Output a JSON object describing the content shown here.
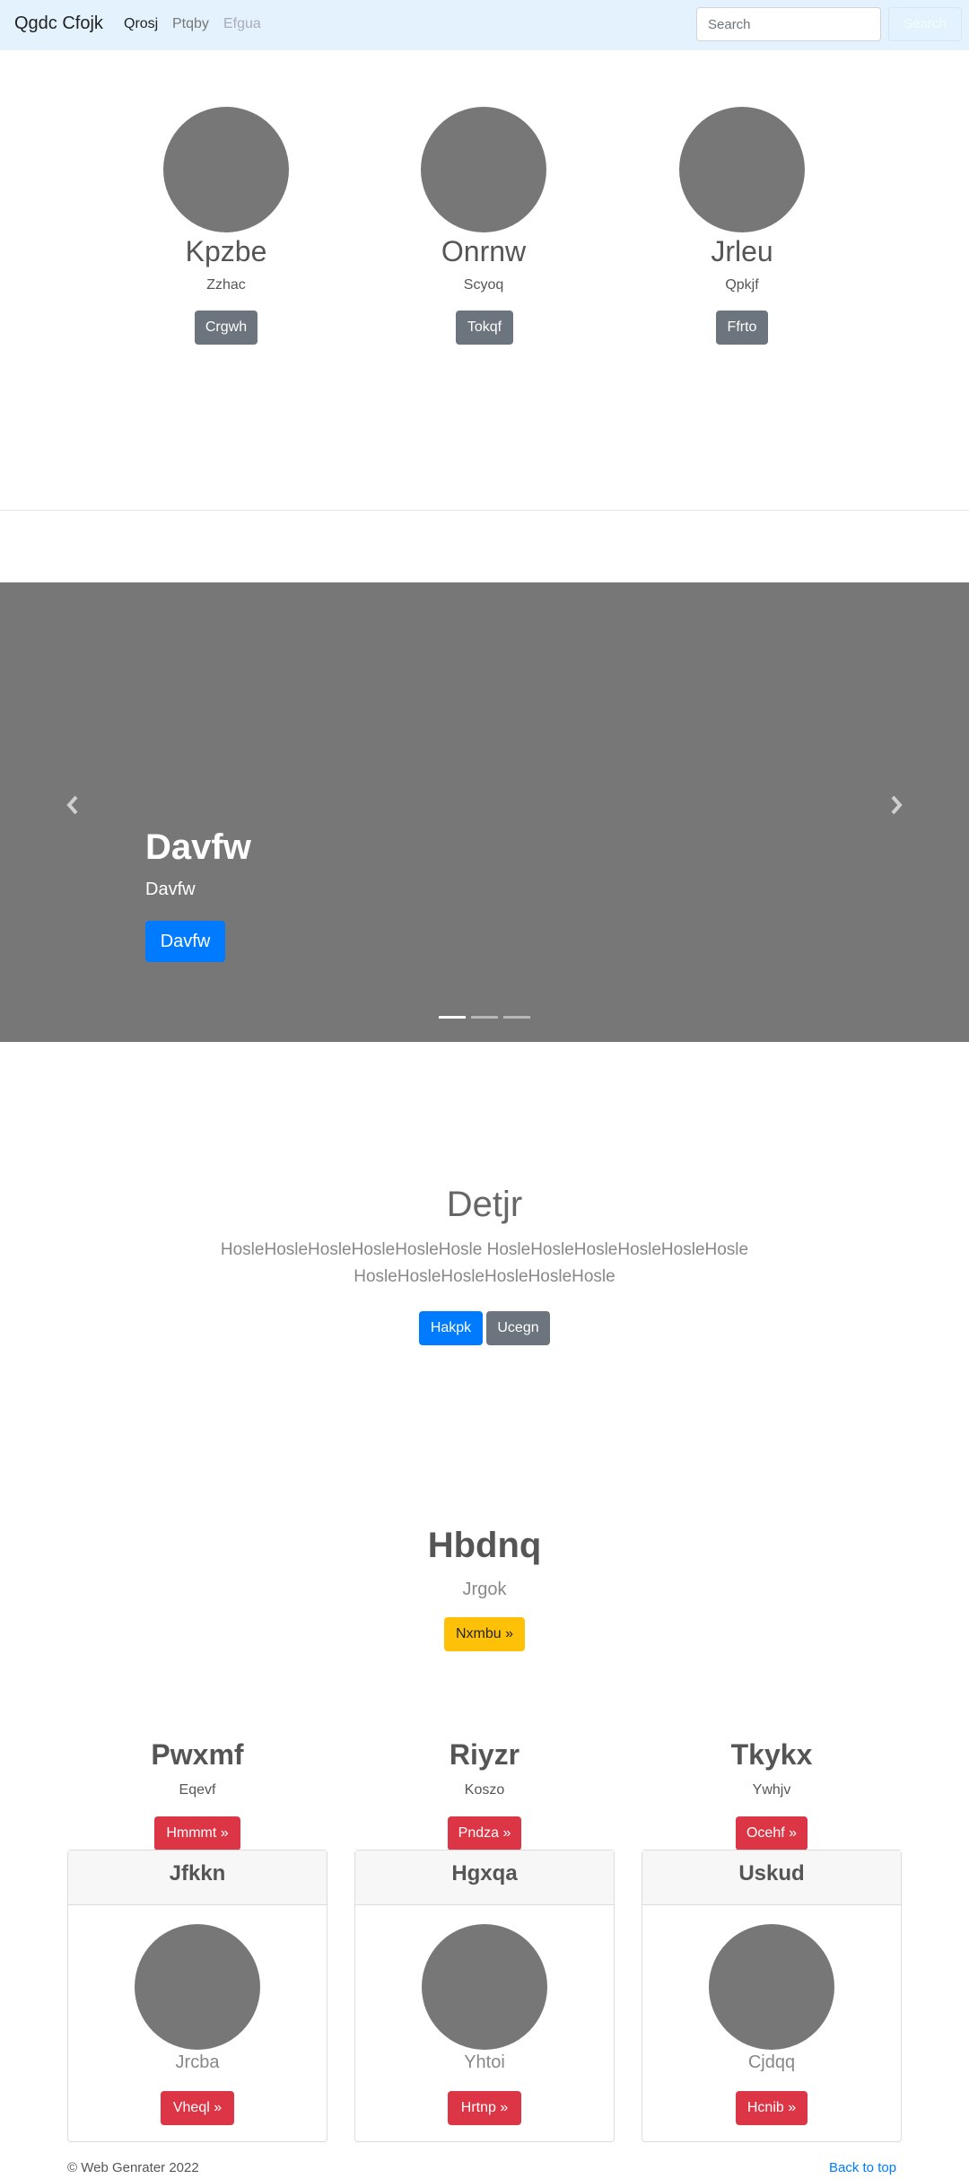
{
  "navbar": {
    "brand": "Qgdc Cfojk",
    "links": [
      "Qrosj",
      "Ptqby",
      "Efgua"
    ],
    "search_placeholder": "Search",
    "search_button": "Search"
  },
  "profiles": [
    {
      "name": "Kpzbe",
      "subtitle": "Zzhac",
      "button": "Crgwh"
    },
    {
      "name": "Onrnw",
      "subtitle": "Scyoq",
      "button": "Tokqf"
    },
    {
      "name": "Jrleu",
      "subtitle": "Qpkjf",
      "button": "Ffrto"
    }
  ],
  "carousel": {
    "title": "Davfw",
    "caption": "Davfw",
    "button": "Davfw",
    "prev_icon": "chevron-left-icon",
    "next_icon": "chevron-right-icon",
    "slides_count": 3,
    "active_slide": 1
  },
  "jumbotron": {
    "title": "Detjr",
    "text_line1": "HosleHosleHosleHosleHosleHosle HosleHosleHosleHosleHosleHosle",
    "text_line2": "HosleHosleHosleHosleHosleHosle",
    "button_primary": "Hakpk",
    "button_secondary": "Ucegn"
  },
  "hero": {
    "title": "Hbdnq",
    "subtitle": "Jrgok",
    "button": "Nxmbu »"
  },
  "features": [
    {
      "title": "Pwxmf",
      "text": "Eqevf",
      "button": "Hmmmt »"
    },
    {
      "title": "Riyzr",
      "text": "Koszo",
      "button": "Pndza »"
    },
    {
      "title": "Tkykx",
      "text": "Ywhjv",
      "button": "Ocehf »"
    }
  ],
  "cards": [
    {
      "header": "Jfkkn",
      "caption": "Jrcba",
      "button": "Vheql »"
    },
    {
      "header": "Hgxqa",
      "caption": "Yhtoi",
      "button": "Hrtnp »"
    },
    {
      "header": "Uskud",
      "caption": "Cjdqq",
      "button": "Hcnib »"
    }
  ],
  "footer": {
    "copyright": "© Web Genrater 2022",
    "back_to_top": "Back to top"
  },
  "colors": {
    "navbar_bg": "#e3f2fd",
    "placeholder_gray": "#777777",
    "primary": "#007bff",
    "secondary": "#6c757d",
    "danger": "#dc3545",
    "warning": "#ffc107"
  }
}
